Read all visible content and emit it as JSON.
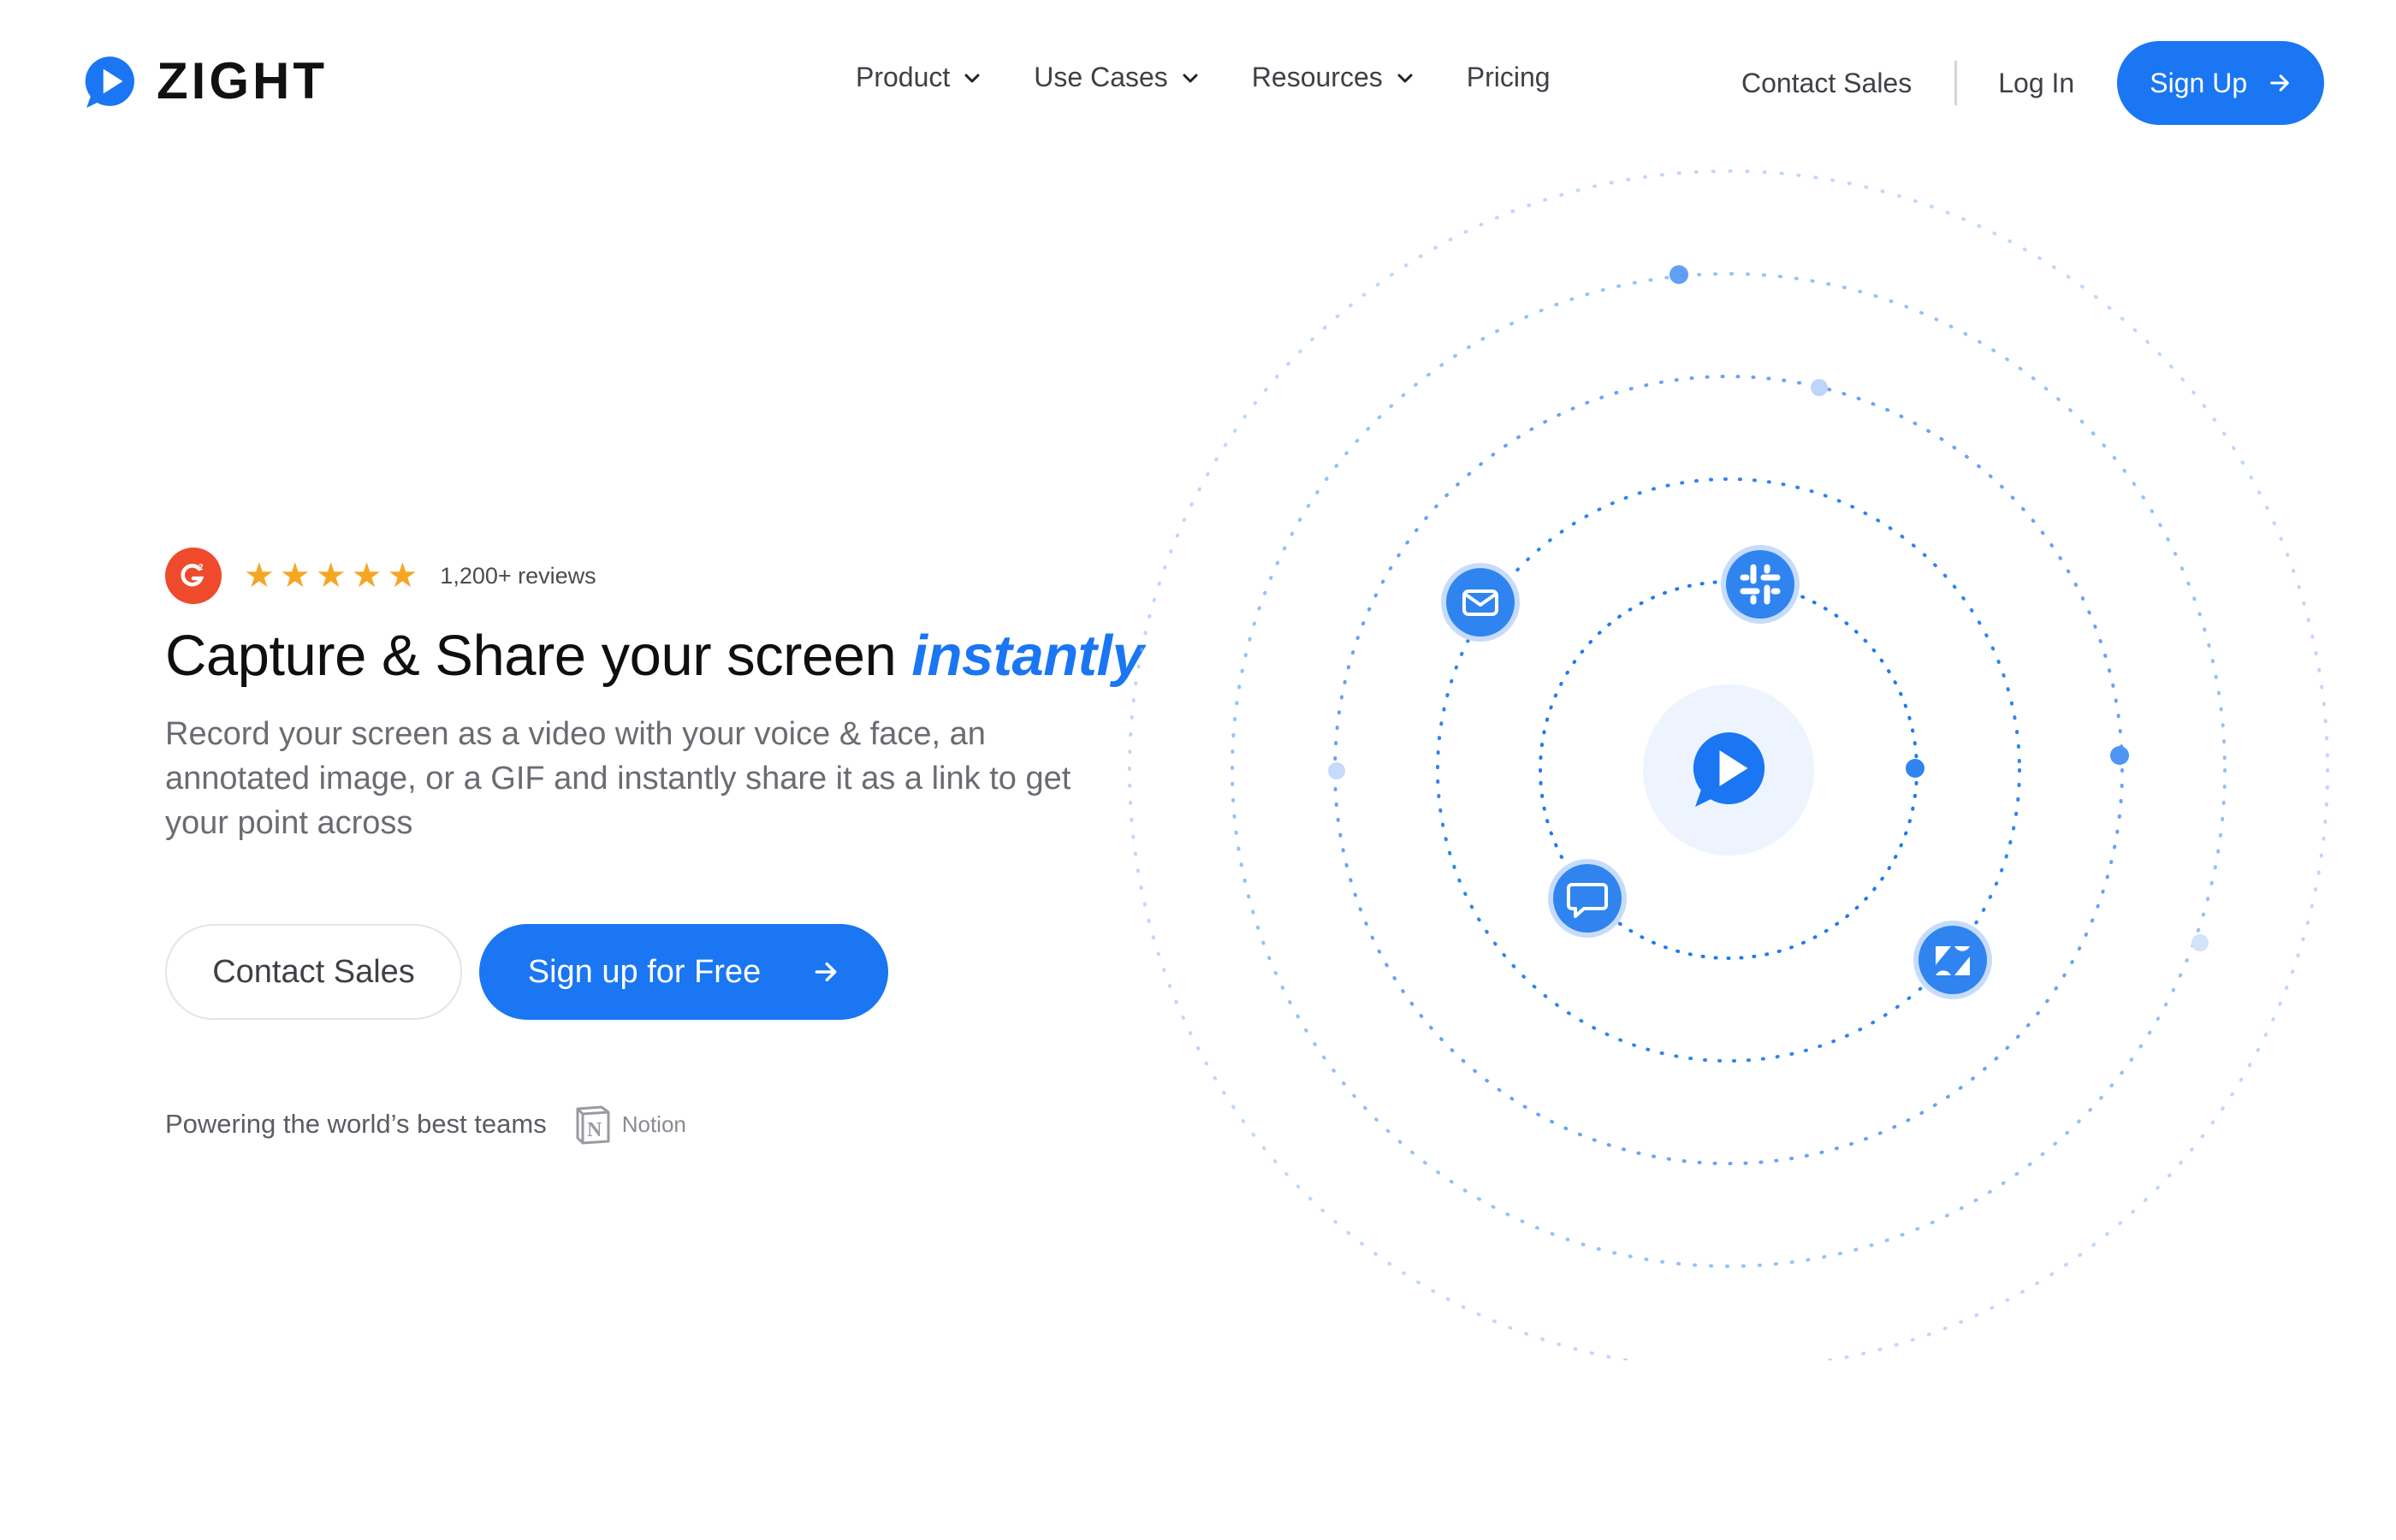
{
  "brand": {
    "name": "ZIGHT",
    "color": "#1a76f2"
  },
  "nav": {
    "items": [
      {
        "label": "Product",
        "has_dropdown": true
      },
      {
        "label": "Use Cases",
        "has_dropdown": true
      },
      {
        "label": "Resources",
        "has_dropdown": true
      },
      {
        "label": "Pricing",
        "has_dropdown": false
      }
    ],
    "contact_sales": "Contact Sales",
    "log_in": "Log In",
    "sign_up": "Sign Up"
  },
  "hero": {
    "rating": {
      "badge": "G2",
      "stars": 5,
      "reviews": "1,200+ reviews"
    },
    "headline_main": "Capture & Share your screen ",
    "headline_accent": "instantly",
    "subcopy": "Record your screen as a video with your voice & face, an annotated image, or a GIF and instantly share it as a link to get your point across",
    "cta_secondary": "Contact Sales",
    "cta_primary": "Sign up for Free",
    "powering": "Powering the world’s best teams",
    "customer_logo": "Notion"
  },
  "orbit": {
    "center_icon": "zight-logo-icon",
    "integrations": [
      "email-icon",
      "slack-icon",
      "chat-icon",
      "zendesk-icon"
    ]
  }
}
